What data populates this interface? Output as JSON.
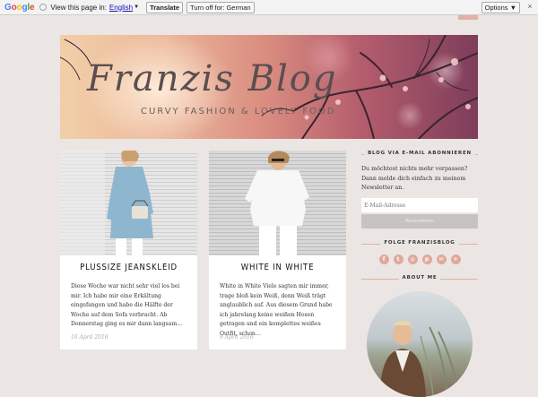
{
  "translate_bar": {
    "logo": [
      "G",
      "o",
      "o",
      "g",
      "l",
      "e"
    ],
    "view_text": "View this page in:",
    "language": "English",
    "translate_button": "Translate",
    "turn_off_button": "Turn off for: German",
    "options_button": "Options ▼",
    "close_icon": "×"
  },
  "header": {
    "title": "Franzis Blog",
    "tagline": "CURVY FASHION & LOVELY FOOD"
  },
  "posts": [
    {
      "title": "PLUSSIZE JEANSKLEID",
      "excerpt": "Diese Woche war nicht sehr viel los bei mir. Ich habe mir eine Erkältung eingefangen und habe die Hälfte der Woche auf dem Sofa verbracht. Ab Donnerstag ging es mir dann langsam…",
      "date": "16 April 2016"
    },
    {
      "title": "WHITE IN WHITE",
      "excerpt": "White in White Viele sagten mir immer, trage bloß kein Weiß, denn Weiß trägt unglaublich auf. Aus diesem Grund habe ich jahrelang keine weißen Hosen getragen und ein komplettes weißes Outfit, schon…",
      "date": "9 April 2016"
    }
  ],
  "sidebar": {
    "newsletter_heading": "BLOG VIA E-MAIL ABONNIEREN",
    "newsletter_text": "Du möchtest nichts mehr verpassen? Dann melde dich einfach zu meinem Newsletter an.",
    "email_placeholder": "E-Mail-Adresse",
    "subscribe_label": "Abonnieren",
    "follow_heading": "FOLGE FRANZISBLOG",
    "social_icons": [
      {
        "name": "facebook-icon",
        "glyph": "f"
      },
      {
        "name": "twitter-icon",
        "glyph": "t"
      },
      {
        "name": "instagram-icon",
        "glyph": "◎"
      },
      {
        "name": "pinterest-icon",
        "glyph": "p"
      },
      {
        "name": "email-icon",
        "glyph": "✉"
      },
      {
        "name": "bloglovin-icon",
        "glyph": "+"
      }
    ],
    "about_heading": "ABOUT ME"
  },
  "colors": {
    "accent": "#e0b1a4",
    "page_background": "#ebe6e3"
  }
}
